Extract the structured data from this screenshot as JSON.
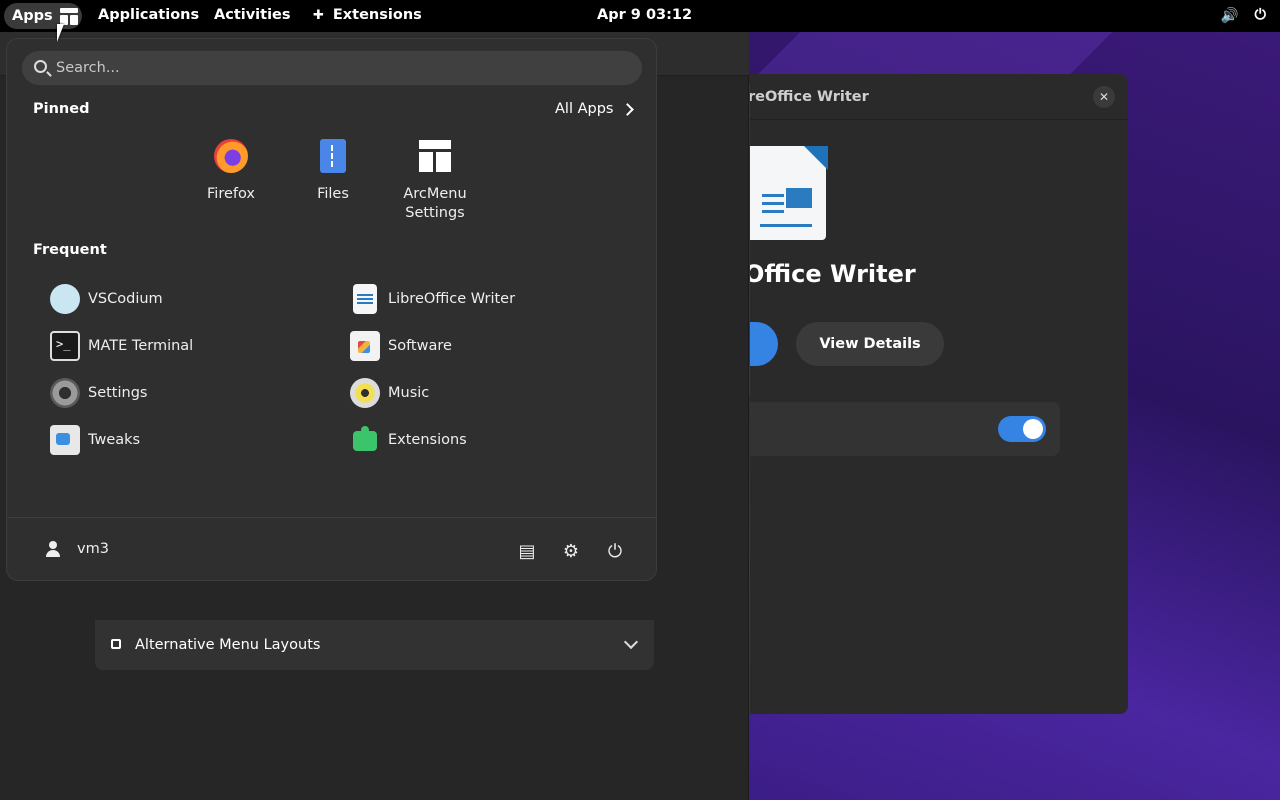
{
  "topbar": {
    "apps_label": "Apps",
    "applications_label": "Applications",
    "activities_label": "Activities",
    "extensions_label": "Extensions",
    "clock": "Apr 9  03:12",
    "volume_icon": "🔊",
    "power_icon": "⏻",
    "extensions_icon": "✚"
  },
  "background_window": {
    "alt_layouts_label": "Alternative Menu Layouts"
  },
  "dialog": {
    "title": "reOffice Writer",
    "app_name": "Office Writer",
    "close_glyph": "✕",
    "view_details_label": "View Details"
  },
  "menu": {
    "search_placeholder": "Search...",
    "pinned_title": "Pinned",
    "all_apps_label": "All Apps",
    "pinned": [
      {
        "label": "Firefox"
      },
      {
        "label": "Files"
      },
      {
        "label": "ArcMenu Settings"
      }
    ],
    "frequent_title": "Frequent",
    "frequent": [
      {
        "label": "VSCodium"
      },
      {
        "label": "LibreOffice Writer"
      },
      {
        "label": "MATE Terminal"
      },
      {
        "label": "Software"
      },
      {
        "label": "Settings"
      },
      {
        "label": "Music"
      },
      {
        "label": "Tweaks"
      },
      {
        "label": "Extensions"
      }
    ],
    "user_name": "vm3",
    "bottom_icons": {
      "documents": "▤",
      "settings": "⚙",
      "power": "⏻"
    }
  },
  "colors": {
    "accent": "#3584e4",
    "menu_bg": "#2f2f2f",
    "topbar_bg": "#000000"
  }
}
